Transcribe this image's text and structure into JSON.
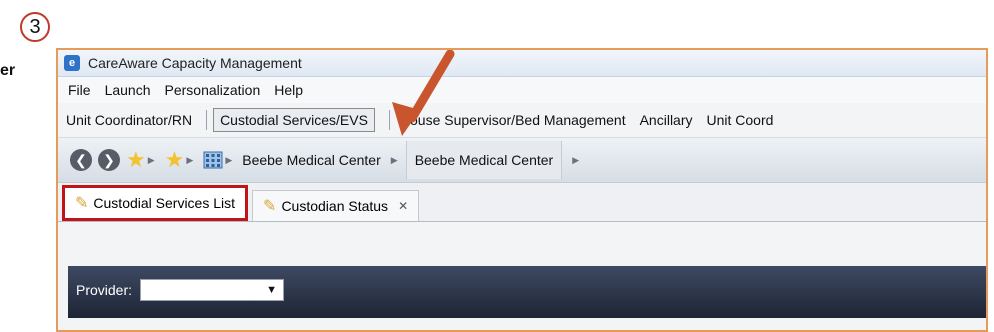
{
  "step_number": "3",
  "left_fragment": "er",
  "window": {
    "title": "CareAware Capacity Management"
  },
  "menu": [
    "File",
    "Launch",
    "Personalization",
    "Help"
  ],
  "roles": [
    {
      "label": "Unit Coordinator/RN"
    },
    {
      "label": "Custodial Services/EVS"
    },
    {
      "label": "House Supervisor/Bed Management"
    },
    {
      "label": "Ancillary"
    },
    {
      "label": "Unit Coord"
    }
  ],
  "navbar": {
    "crumbs": [
      "Beebe Medical Center",
      "Beebe Medical Center"
    ]
  },
  "tabs": [
    {
      "label": "Custodial Services List"
    },
    {
      "label": "Custodian Status"
    }
  ],
  "filter": {
    "provider_label": "Provider:",
    "provider_value": ""
  },
  "colors": {
    "highlight_border": "#c0141a",
    "annotation_arrow": "#c9552e",
    "step_circle": "#c0392b"
  }
}
